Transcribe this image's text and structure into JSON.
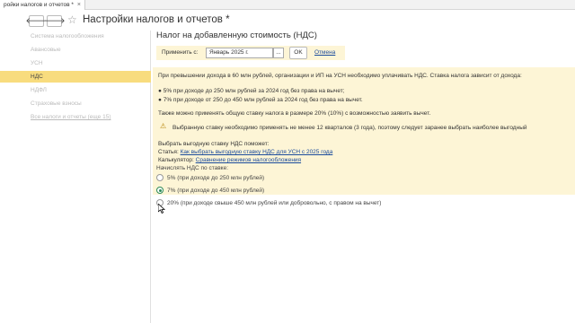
{
  "tab": {
    "label": "ройки налогов и отчетов *",
    "close": "×"
  },
  "nav": {
    "back": "🡐",
    "forward": "🡒",
    "favorite": "☆"
  },
  "page": {
    "title": "Настройки налогов и отчетов *"
  },
  "sidebar": {
    "items": [
      {
        "label": "Система налогообложения"
      },
      {
        "label": "Авансовые"
      },
      {
        "label": "УСН"
      },
      {
        "label": "НДС"
      },
      {
        "label": "НДФЛ"
      },
      {
        "label": "Страховые взносы"
      },
      {
        "label": "Все налоги и отчеты (еще 15)"
      }
    ]
  },
  "main": {
    "section_title": "Налог на добавленную стоимость (НДС)",
    "apply_label": "Применить с:",
    "period_value": "Январь 2025 г.",
    "period_pick": "...",
    "ok_label": "OK",
    "cancel_label": "Отмена",
    "info": {
      "line1": "При превышении дохода в 60 млн рублей, организации и ИП на УСН необходимо уплачивать НДС. Ставка налога зависит от дохода:",
      "bullet1": "5% при доходе до 250 млн рублей за 2024 год без права на вычет;",
      "bullet2": "7% при доходе от 250 до 450 млн рублей за 2024 год без права на вычет.",
      "line2": "Также можно применять общую ставку налога в размере 20% (10%) с возможностью заявить вычет.",
      "warning": "Выбранную ставку необходимо применять не менее 12 кварталов (3 года), поэтому следует заранее выбрать наиболее выгодный",
      "help_title": "Выбрать выгодную ставку НДС поможет:",
      "article_prefix": "Статья:",
      "article_link": "Как выбрать выгодную ставку НДС для УСН с 2025 года",
      "calc_prefix": "Калькулятор:",
      "calc_link": "Сравнение режимов налогообложения",
      "warning_icon": "⚠"
    },
    "rate_label": "Начислять НДС по ставке:",
    "rates": [
      {
        "label": "5% (при доходе до 250 млн рублей)",
        "checked": false
      },
      {
        "label": "7% (при доходе до 450 млн рублей)",
        "checked": true
      },
      {
        "label": "20% (при доходе свыше 450 млн рублей или добровольно, с правом на вычет)",
        "checked": false
      }
    ]
  }
}
